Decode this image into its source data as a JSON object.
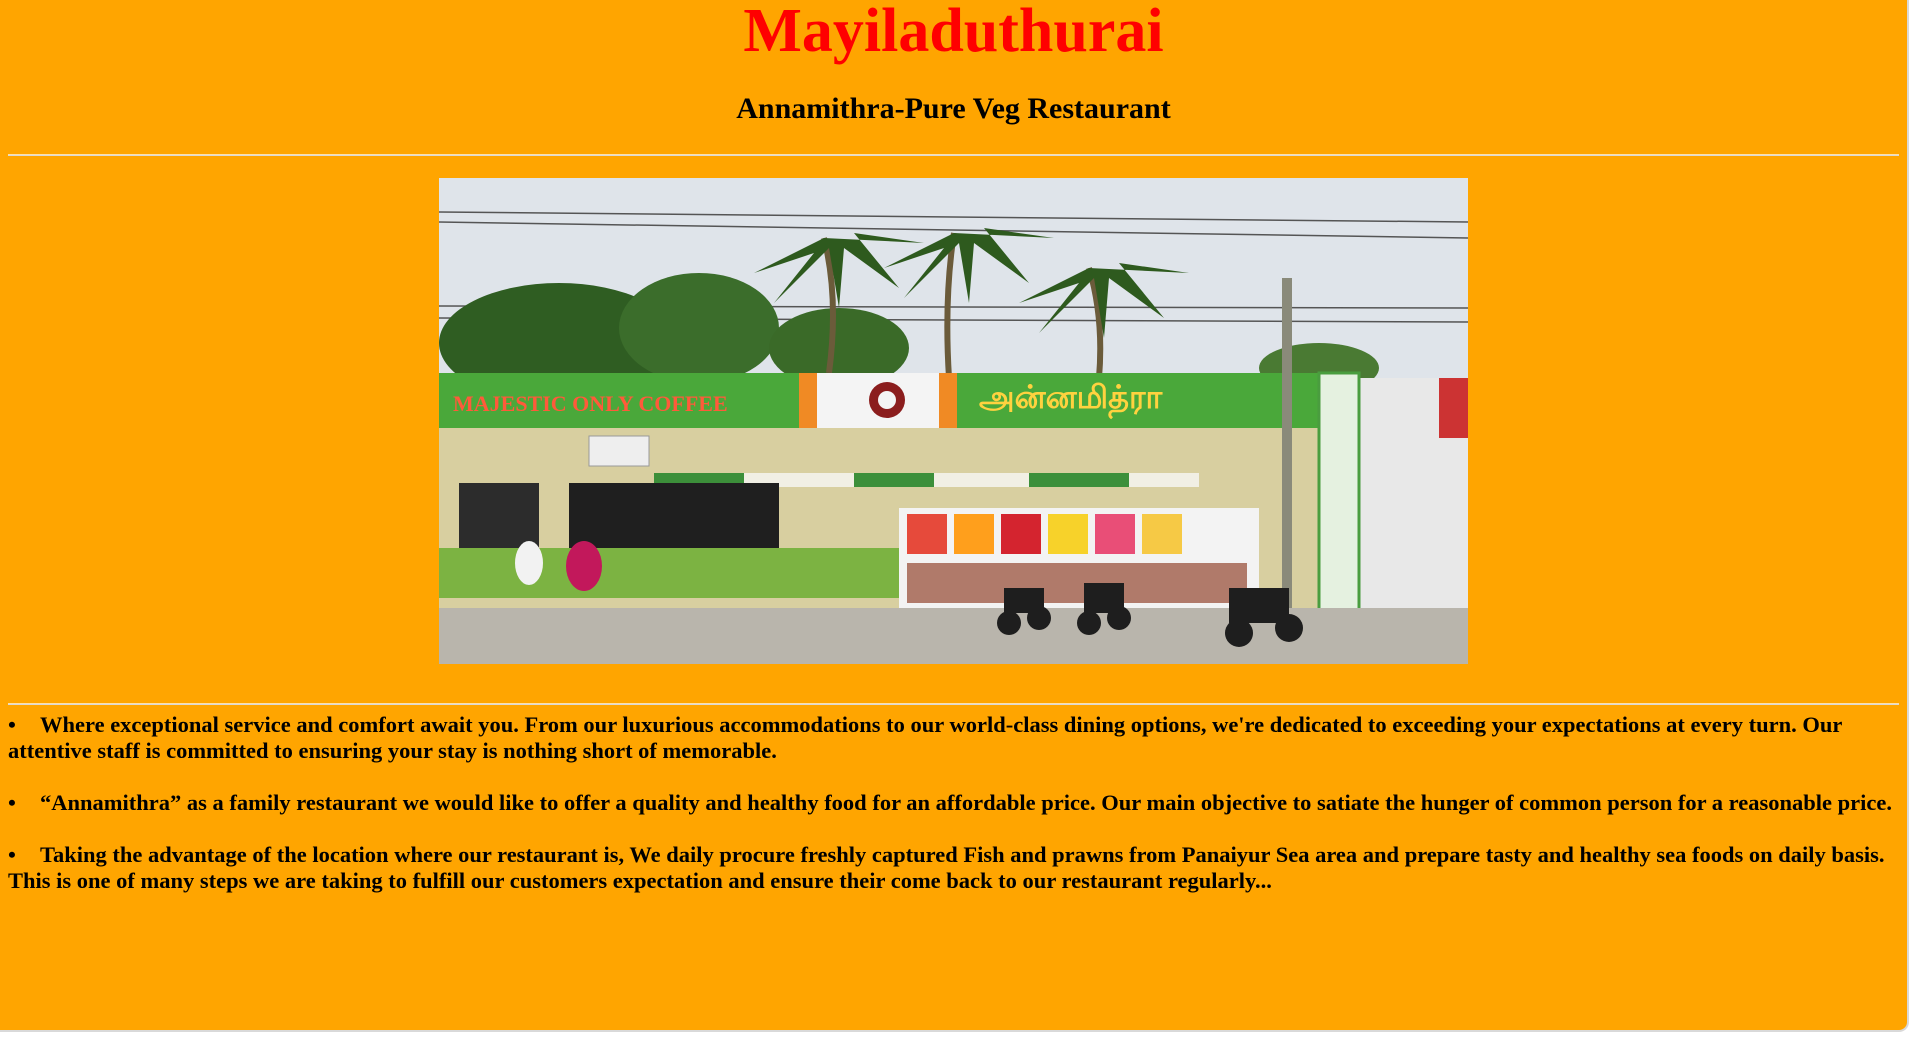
{
  "page": {
    "title": "Mayiladuthurai",
    "subtitle": "Annamithra-Pure Veg Restaurant",
    "colors": {
      "background": "#ffa500",
      "title": "#ff0000",
      "text": "#000000"
    }
  },
  "photo": {
    "description_icon": "restaurant-storefront-image",
    "signs": {
      "left": "MAJESTIC ONLY COFFEE",
      "right": "அன்னமித்ரா"
    }
  },
  "features": [
    {
      "bullet": "•",
      "text": "Where exceptional service and comfort await you. From our luxurious accommodations to our world-class dining options, we're dedicated to exceeding your expectations at every turn. Our attentive staff is committed to ensuring your stay is nothing short of memorable."
    },
    {
      "bullet": "•",
      "text": "“Annamithra” as a family restaurant we would like to offer a quality and healthy food for an affordable price. Our main objective to satiate the hunger of common person for a reasonable price."
    },
    {
      "bullet": "•",
      "text": "Taking the advantage of the location where our restaurant is, We daily procure freshly captured Fish and prawns from Panaiyur Sea area and prepare tasty and healthy sea foods on daily basis. This is one of many steps we are taking to fulfill our customers expectation and ensure their come back to our restaurant regularly..."
    }
  ]
}
